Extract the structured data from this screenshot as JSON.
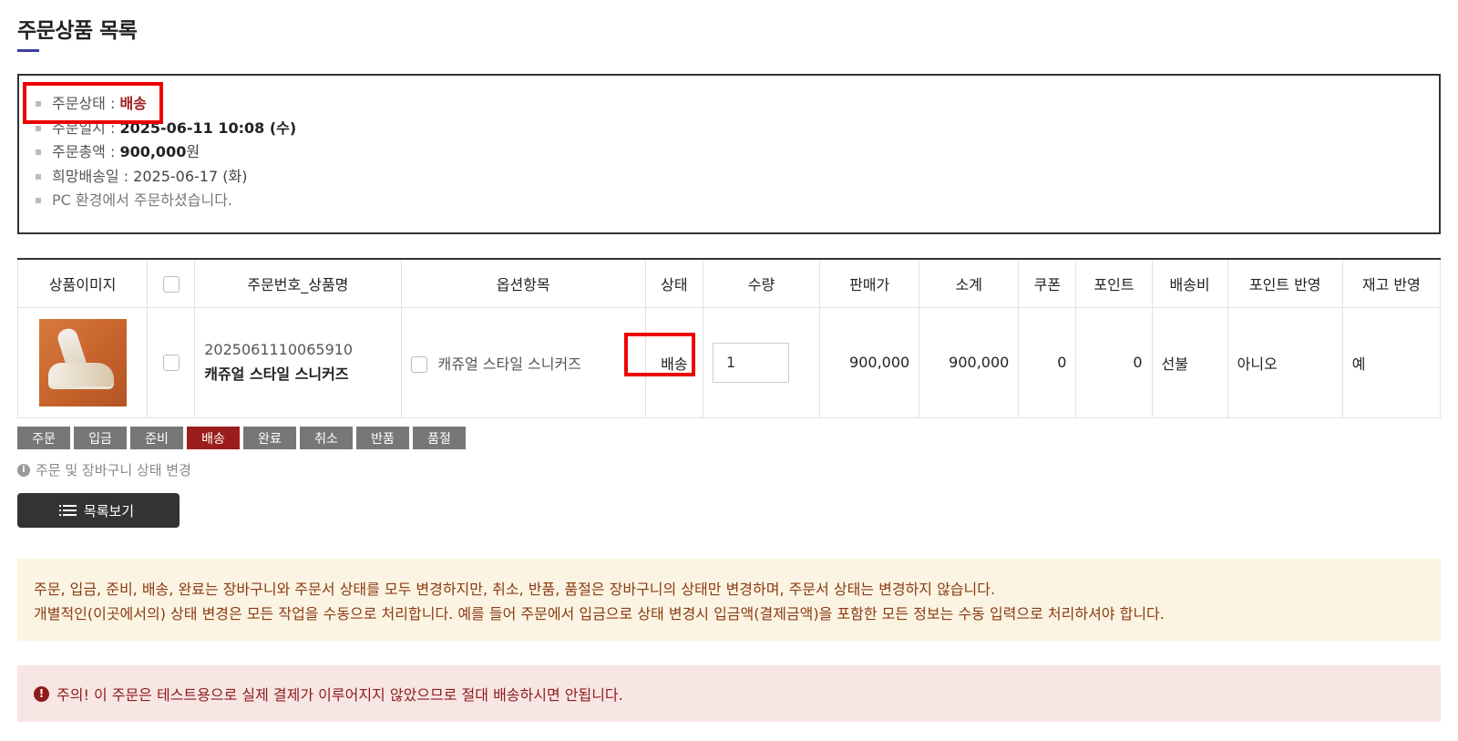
{
  "section_title": "주문상품 목록",
  "order_info": {
    "status_label": "주문상태 : ",
    "status_value": "배송",
    "date_label": "주문일시 : ",
    "date_value": "2025-06-11 10:08 (수)",
    "total_label": "주문총액 : ",
    "total_value": "900,000",
    "total_unit": "원",
    "delivery_label": "희망배송일 : ",
    "delivery_value": "2025-06-17 (화)",
    "env_note": "PC 환경에서 주문하셨습니다."
  },
  "table": {
    "headers": [
      "상품이미지",
      "",
      "주문번호_상품명",
      "옵션항목",
      "상태",
      "수량",
      "판매가",
      "소계",
      "쿠폰",
      "포인트",
      "배송비",
      "포인트 반영",
      "재고 반영"
    ],
    "row": {
      "order_no": "2025061110065910",
      "product_name": "캐쥬얼 스타일 스니커즈",
      "option": "캐쥬얼 스타일 스니커즈",
      "status": "배송",
      "quantity": "1",
      "price": "900,000",
      "subtotal": "900,000",
      "coupon": "0",
      "point": "0",
      "shipping": "선불",
      "point_applied": "아니오",
      "stock_applied": "예"
    }
  },
  "status_buttons": [
    "주문",
    "입금",
    "준비",
    "배송",
    "완료",
    "취소",
    "반품",
    "품절"
  ],
  "active_status": "배송",
  "help_text": "주문 및 장바구니 상태 변경",
  "list_button": "목록보기",
  "notice_warn": {
    "line1": "주문, 입금, 준비, 배송, 완료는 장바구니와 주문서 상태를 모두 변경하지만, 취소, 반품, 품절은 장바구니의 상태만 변경하며, 주문서 상태는 변경하지 않습니다.",
    "line2": "개별적인(이곳에서의) 상태 변경은 모든 작업을 수동으로 처리합니다. 예를 들어 주문에서 입금으로 상태 변경시 입금액(결제금액)을 포함한 모든 정보는 수동 입력으로 처리하셔야 합니다."
  },
  "notice_danger": "주의! 이 주문은 테스트용으로 실제 결제가 이루어지지 않았으므로 절대 배송하시면 안됩니다.",
  "colors": {
    "accent_red": "#9b1c1c",
    "highlight": "#ee0000",
    "title_underline": "#3a3f9a",
    "warn_bg": "#fcf4e3",
    "danger_bg": "#f7e6e4"
  }
}
